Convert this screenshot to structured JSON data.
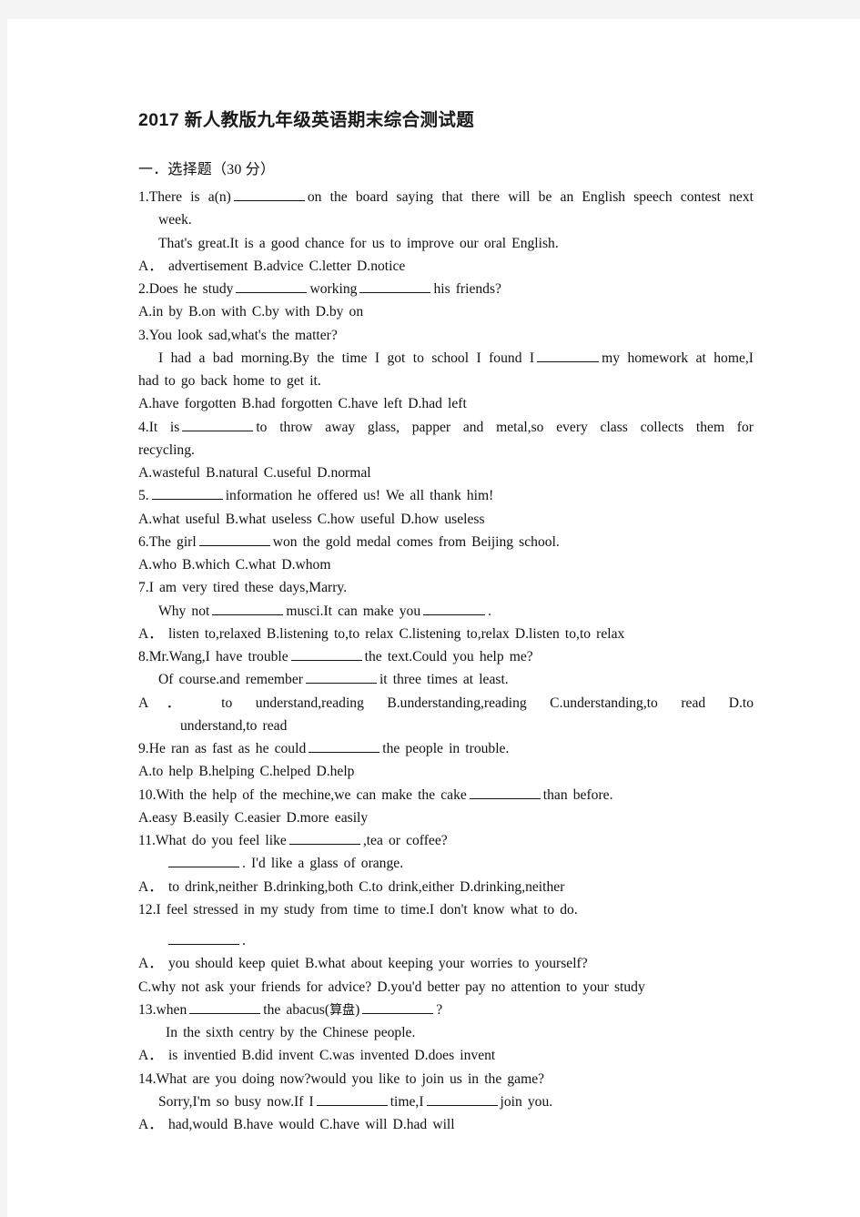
{
  "document": {
    "title": "2017 新人教版九年级英语期末综合测试题",
    "section_heading": "一．选择题（30 分）",
    "lines": {
      "q1_a": "1.There is a(n)",
      "q1_b": "on the board saying that there will be an English speech contest next",
      "q1_c": "week.",
      "q1_d": "That's great.It is a good chance for us to improve our oral English.",
      "q1_opts": "A． advertisement   B.advice   C.letter   D.notice",
      "q2_a": "2.Does he study",
      "q2_b": "working",
      "q2_c": "his friends?",
      "q2_opts": "A.in by   B.on with   C.by with   D.by on",
      "q3_a": "3.You look sad,what's the matter?",
      "q3_b": "I had a bad morning.By the time I got to school I found I",
      "q3_c": "my homework at home,I",
      "q3_d": "had to go back home to get it.",
      "q3_opts": "A.have forgotten   B.had forgotten   C.have left   D.had left",
      "q4_a": "4.It is",
      "q4_b": "to throw away glass, papper and metal,so every class collects them for",
      "q4_c": "recycling.",
      "q4_opts": "A.wasteful   B.natural   C.useful   D.normal",
      "q5_a": "5.",
      "q5_b": "information he offered us! We all thank him!",
      "q5_opts": "A.what useful   B.what useless   C.how useful    D.how useless",
      "q6_a": "6.The girl",
      "q6_b": "won the gold medal comes from Beijing school.",
      "q6_opts": "A.who   B.which   C.what   D.whom",
      "q7_a": "7.I am very tired these days,Marry.",
      "q7_b": "Why not",
      "q7_c": "musci.It can make you",
      "q7_d": ".",
      "q7_opts": "A． listen to,relaxed   B.listening to,to relax   C.listening to,relax   D.listen to,to relax",
      "q8_a": "8.Mr.Wang,I have trouble",
      "q8_b": "the text.Could you help me?",
      "q8_c": "Of course.and remember",
      "q8_d": "it three times at least.",
      "q8_opts_a": "A． to understand,reading        B.understanding,reading        C.understanding,to read        D.to",
      "q8_opts_b": "understand,to read",
      "q9_a": "9.He ran as fast as he could",
      "q9_b": "the people in trouble.",
      "q9_opts": "A.to help   B.helping   C.helped   D.help",
      "q10_a": "10.With the help of the mechine,we can make the cake",
      "q10_b": "than before.",
      "q10_opts": "A.easy   B.easily   C.easier   D.more easily",
      "q11_a": "11.What do you feel like",
      "q11_b": ",tea or coffee?",
      "q11_c": ". I'd like a glass of orange.",
      "q11_opts": "A． to drink,neither   B.drinking,both   C.to drink,either   D.drinking,neither",
      "q12_a": "12.I feel stressed in my study from time to time.I don't know what to do.",
      "q12_b": ".",
      "q12_opts_a": "A． you should keep quiet   B.what about keeping your worries to yourself?",
      "q12_opts_b": "C.why not ask your friends for advice?   D.you'd better pay no attention to your study",
      "q13_a": "13.when",
      "q13_b": "the abacus(",
      "q13_cjk": "算盘",
      "q13_c": ")",
      "q13_d": "?",
      "q13_e": "In the sixth centry by the Chinese people.",
      "q13_opts": "A． is inventied   B.did invent   C.was invented   D.does invent",
      "q14_a": "14.What are you doing now?would you like to join us in the game?",
      "q14_b": "Sorry,I'm so busy now.If I",
      "q14_c": "time,I",
      "q14_d": "join you.",
      "q14_opts": "A． had,would   B.have would   C.have will   D.had will"
    }
  }
}
